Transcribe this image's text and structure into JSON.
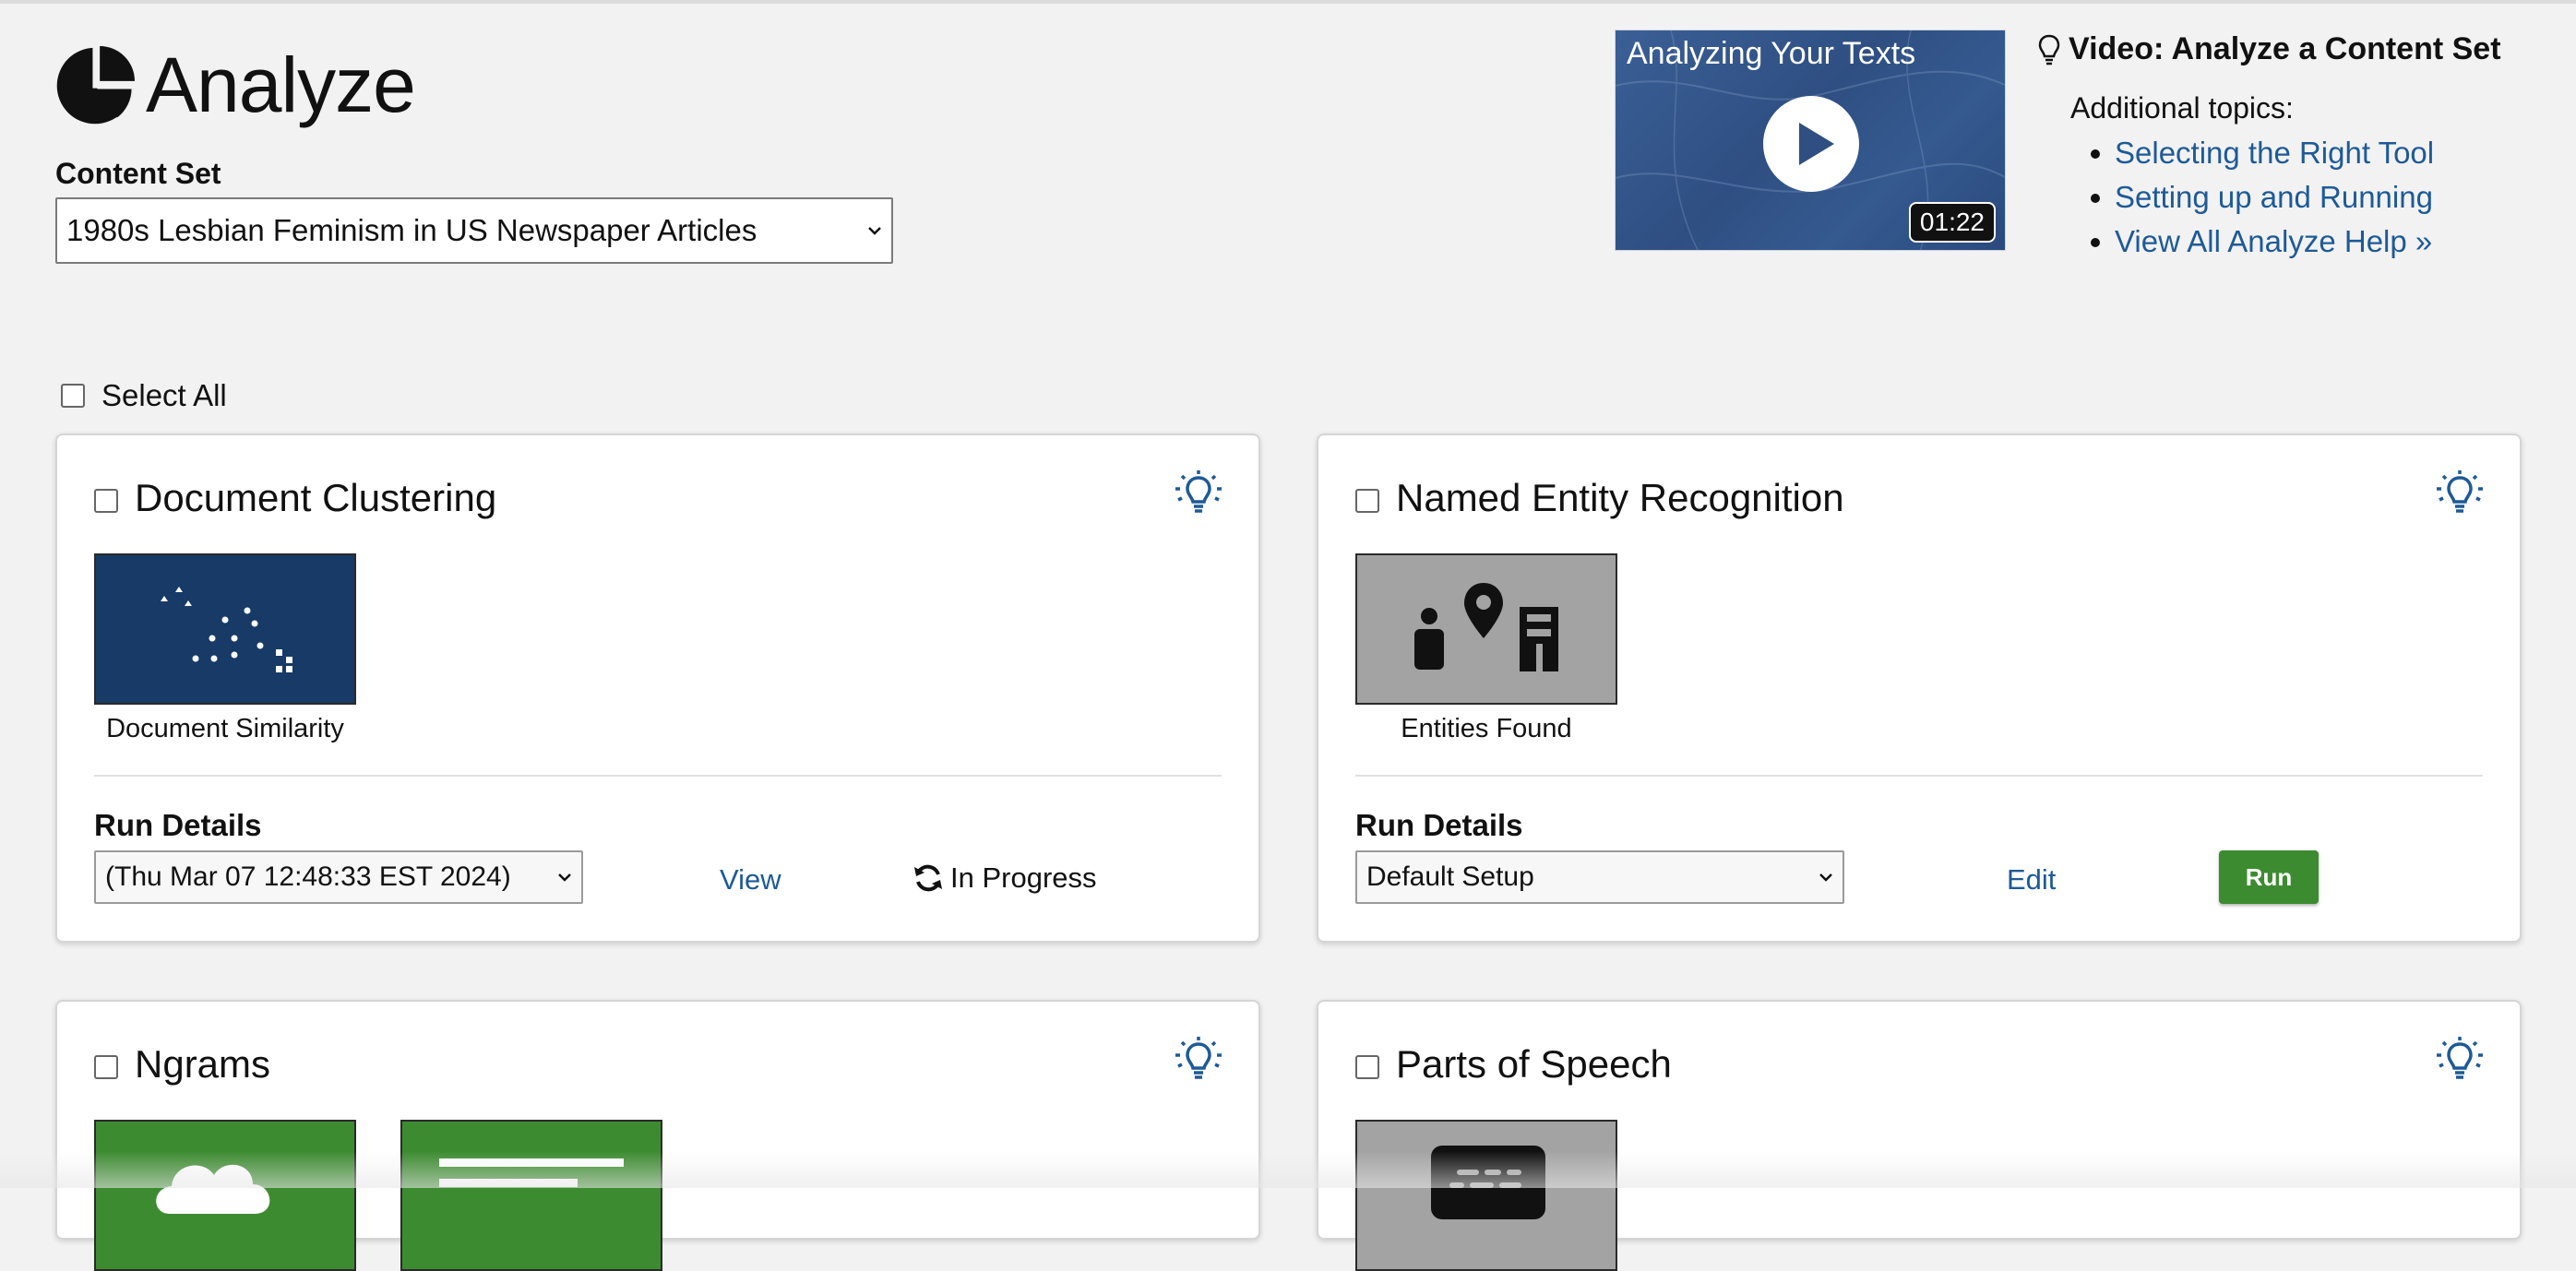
{
  "header": {
    "title": "Analyze",
    "content_set_label": "Content Set",
    "content_set_value": "1980s Lesbian Feminism in US Newspaper Articles"
  },
  "video": {
    "thumb_title": "Analyzing Your Texts",
    "duration": "01:22",
    "title": "Video: Analyze a Content Set",
    "topics_label": "Additional topics:",
    "topics": [
      "Selecting the Right Tool",
      "Setting up and Running",
      "View All Analyze Help »"
    ]
  },
  "select_all_label": "Select All",
  "cards": [
    {
      "title": "Document Clustering",
      "tiles": [
        {
          "caption": "Document Similarity",
          "icon": "scatter-cluster-icon",
          "color": "#173a66"
        }
      ],
      "run_label": "Run Details",
      "run_select": "(Thu Mar 07 12:48:33 EST 2024)",
      "action_link": "View",
      "status": "In Progress"
    },
    {
      "title": "Named Entity Recognition",
      "tiles": [
        {
          "caption": "Entities Found",
          "icon": "person-location-building-icon",
          "color": "#a3a3a3"
        }
      ],
      "run_label": "Run Details",
      "run_select": "Default Setup",
      "action_link": "Edit",
      "run_button": "Run"
    },
    {
      "title": "Ngrams",
      "tiles": [
        {
          "icon": "word-cloud-icon",
          "color": "#3d8b31"
        },
        {
          "icon": "text-lines-icon",
          "color": "#3d8b31"
        }
      ]
    },
    {
      "title": "Parts of Speech",
      "tiles": [
        {
          "icon": "speech-tags-icon",
          "color": "#a3a3a3"
        }
      ]
    }
  ],
  "colors": {
    "link": "#1e5a96",
    "run_button": "#3d8b31",
    "clustering_tile": "#173a66",
    "ner_tile": "#a3a3a3"
  }
}
